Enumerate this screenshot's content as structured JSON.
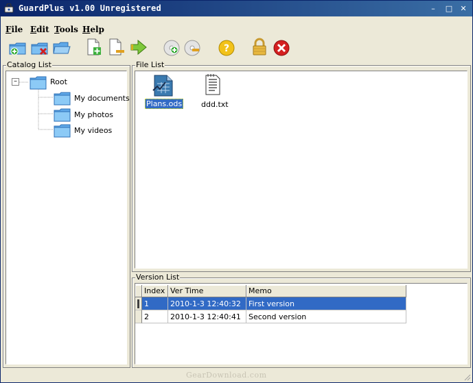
{
  "window": {
    "title": "GuardPlus v1.00 Unregistered",
    "controls": {
      "minimize": "–",
      "maximize": "□",
      "close": "✕"
    }
  },
  "menu": [
    {
      "label": "File",
      "hotkey": "F",
      "rest": "ile"
    },
    {
      "label": "Edit",
      "hotkey": "E",
      "rest": "dit"
    },
    {
      "label": "Tools",
      "hotkey": "T",
      "rest": "ools"
    },
    {
      "label": "Help",
      "hotkey": "H",
      "rest": "elp"
    }
  ],
  "toolbar": {
    "icons": [
      "add-catalog-icon",
      "delete-catalog-icon",
      "open-folder-icon",
      "add-file-icon",
      "remove-file-icon",
      "go-arrow-icon",
      "add-version-icon",
      "restore-version-icon",
      "help-icon",
      "lock-icon",
      "exit-icon"
    ]
  },
  "catalog": {
    "label": "Catalog List",
    "root": "Root",
    "expander": "–",
    "children": [
      "My documents",
      "My photos",
      "My videos"
    ]
  },
  "files": {
    "label": "File List",
    "items": [
      {
        "name": "Plans.ods",
        "selected": true,
        "icon": "spreadsheet-file-icon"
      },
      {
        "name": "ddd.txt",
        "selected": false,
        "icon": "text-file-icon"
      }
    ]
  },
  "versions": {
    "label": "Version List",
    "columns": [
      "Index",
      "Ver Time",
      "Memo"
    ],
    "rows": [
      {
        "index": "1",
        "time": "2010-1-3 12:40:32",
        "memo": "First version",
        "selected": true
      },
      {
        "index": "2",
        "time": "2010-1-3 12:40:41",
        "memo": "Second version",
        "selected": false
      }
    ]
  },
  "status": {
    "watermark": "GearDownload.com"
  },
  "colors": {
    "title_start": "#0a246a",
    "title_end": "#3a6ea5",
    "selection": "#316ac5",
    "face": "#ece9d8"
  }
}
